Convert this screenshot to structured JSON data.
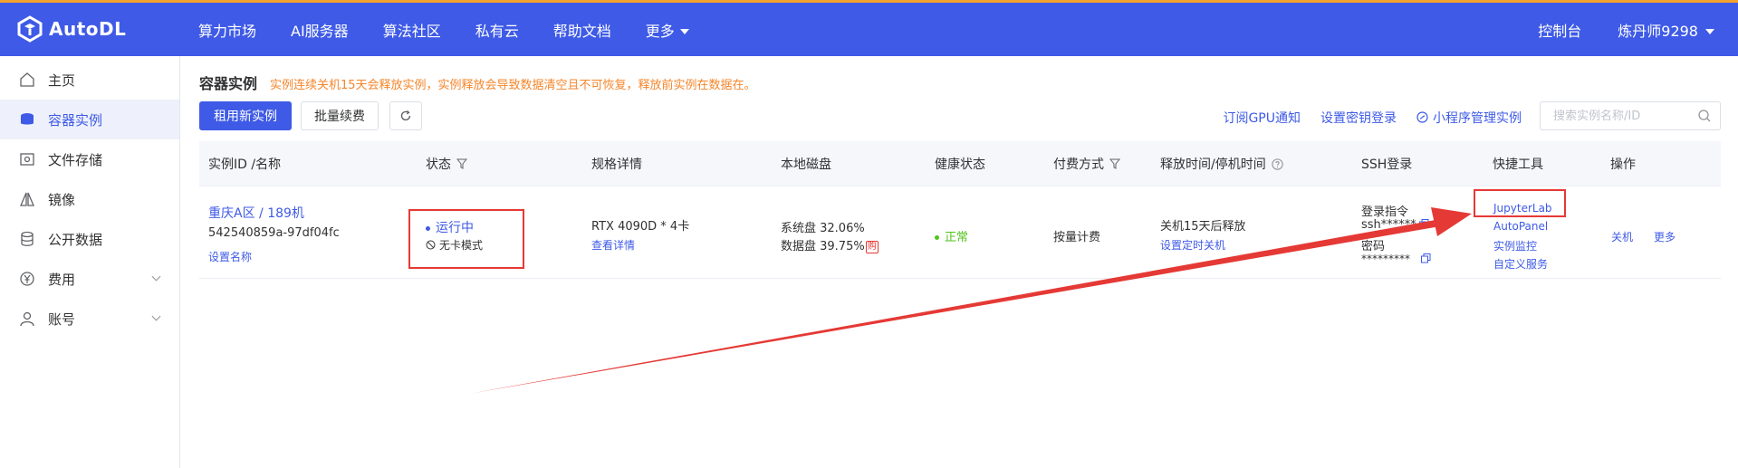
{
  "brand": {
    "name": "AutoDL"
  },
  "nav": {
    "items": [
      "算力市场",
      "AI服务器",
      "算法社区",
      "私有云",
      "帮助文档"
    ],
    "more": "更多"
  },
  "header_right": {
    "console": "控制台",
    "user": "炼丹师9298"
  },
  "sidebar": {
    "items": [
      {
        "label": "主页",
        "icon": "home-icon"
      },
      {
        "label": "容器实例",
        "icon": "instances-icon"
      },
      {
        "label": "文件存储",
        "icon": "storage-icon"
      },
      {
        "label": "镜像",
        "icon": "image-icon"
      },
      {
        "label": "公开数据",
        "icon": "database-icon"
      },
      {
        "label": "费用",
        "icon": "yen-icon"
      },
      {
        "label": "账号",
        "icon": "user-icon"
      }
    ]
  },
  "page": {
    "title": "容器实例",
    "warning": "实例连续关机15天会释放实例，实例释放会导致数据清空且不可恢复，释放前实例在数据在。",
    "btn_new": "租用新实例",
    "btn_batch": "批量续费",
    "link_gpu": "订阅GPU通知",
    "link_ssh_key": "设置密钥登录",
    "link_miniapp": "小程序管理实例",
    "search_placeholder": "搜索实例名称/ID"
  },
  "table": {
    "headers": {
      "id": "实例ID /名称",
      "status": "状态",
      "spec": "规格详情",
      "disk": "本地磁盘",
      "health": "健康状态",
      "billing": "付费方式",
      "release": "释放时间/停机时间",
      "ssh": "SSH登录",
      "tools": "快捷工具",
      "ops": "操作"
    },
    "row": {
      "region": "重庆A区 / 189机",
      "instance_id": "542540859a-97df04fc",
      "set_name": "设置名称",
      "status": "运行中",
      "mode": "无卡模式",
      "gpu": "RTX 4090D * 4卡",
      "spec_detail": "查看详情",
      "sys_disk": "系统盘 32.06%",
      "data_disk": "数据盘 39.75%",
      "data_disk_tag": "购",
      "health": "正常",
      "billing": "按量计费",
      "release": "关机15天后释放",
      "timer": "设置定时关机",
      "ssh_cmd_label": "登录指令",
      "ssh_cmd": "ssh******",
      "pwd_label": "密码",
      "pwd": "*********",
      "tool_jupyter": "JupyterLab",
      "tool_autopanel": "AutoPanel",
      "tool_monitor": "实例监控",
      "tool_custom": "自定义服务",
      "op_shutdown": "关机",
      "op_more": "更多"
    }
  },
  "colors": {
    "primary": "#3e5ae6",
    "accent_top": "#f5a12b",
    "warning": "#f5862b",
    "success": "#52c41a",
    "annotation": "#e53935"
  }
}
